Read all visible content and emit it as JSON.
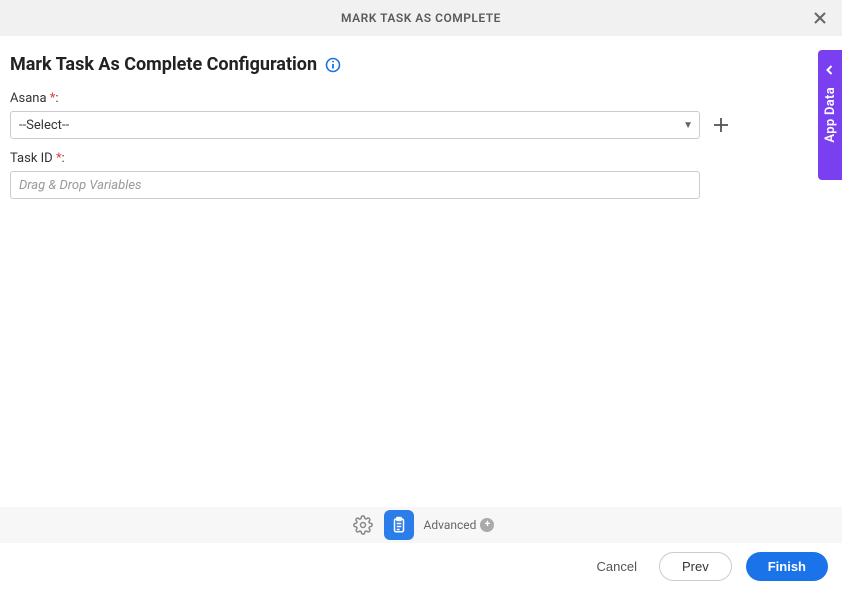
{
  "header": {
    "title": "MARK TASK AS COMPLETE"
  },
  "page": {
    "title": "Mark Task As Complete Configuration"
  },
  "fields": {
    "asana": {
      "label": "Asana ",
      "required_suffix": ":",
      "selected": "--Select--"
    },
    "task_id": {
      "label": "Task ID ",
      "required_suffix": ":",
      "placeholder": "Drag & Drop Variables",
      "value": ""
    }
  },
  "side_tab": {
    "label": "App Data"
  },
  "toolbar": {
    "advanced_label": "Advanced"
  },
  "footer": {
    "cancel": "Cancel",
    "prev": "Prev",
    "finish": "Finish"
  }
}
